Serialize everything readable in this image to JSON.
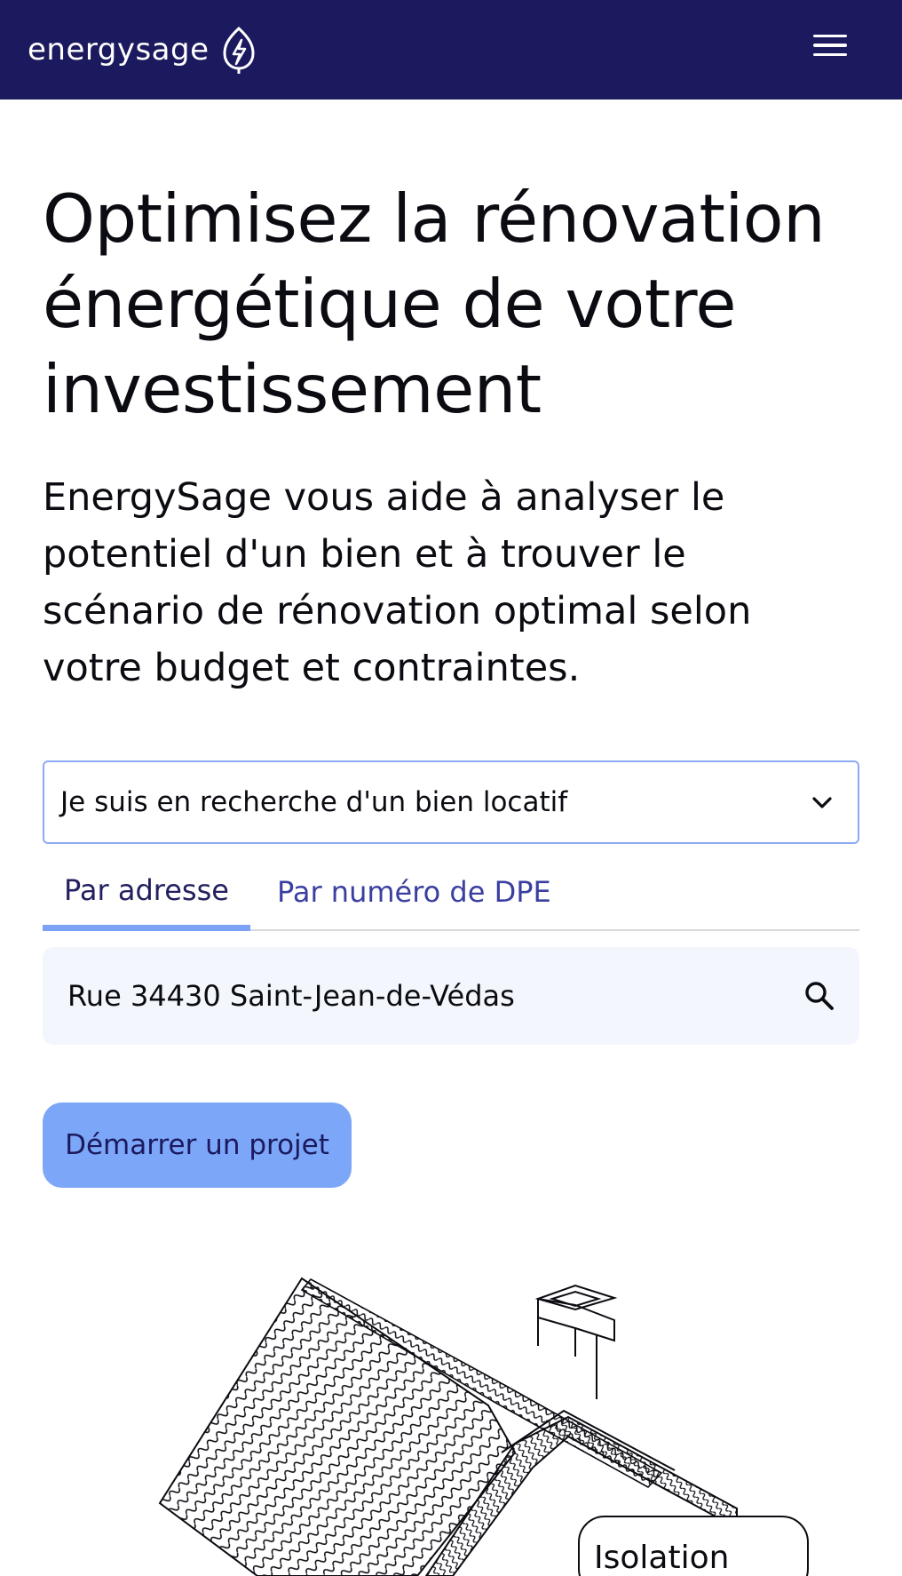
{
  "header": {
    "logo_text": "energysage",
    "logo_icon": "bolt-leaf-icon",
    "menu_icon": "hamburger-menu-icon",
    "background_color": "#1c1a5e"
  },
  "hero": {
    "title": "Optimisez la rénovation énergétique de votre investissement",
    "subtitle": "EnergySage vous aide à analyser le potentiel d'un bien et à trouver le scénario de rénovation optimal selon votre budget et contraintes."
  },
  "search_form": {
    "profile_select": {
      "value": "Je suis en recherche d'un bien locatif",
      "icon": "chevron-down-icon"
    },
    "tabs": [
      {
        "label": "Par adresse",
        "active": true
      },
      {
        "label": "Par numéro de DPE",
        "active": false
      }
    ],
    "address_input": {
      "value": "Rue 34430 Saint-Jean-de-Védas",
      "icon": "search-icon"
    },
    "start_button_label": "Démarrer un projet"
  },
  "illustration": {
    "label": "Isolation",
    "description_icon": "house-roof-illustration"
  },
  "colors": {
    "accent": "#7ca6f8",
    "brand_dark": "#1c1a5e",
    "input_bg": "#f4f6fd",
    "select_border": "#8eaaf5"
  }
}
